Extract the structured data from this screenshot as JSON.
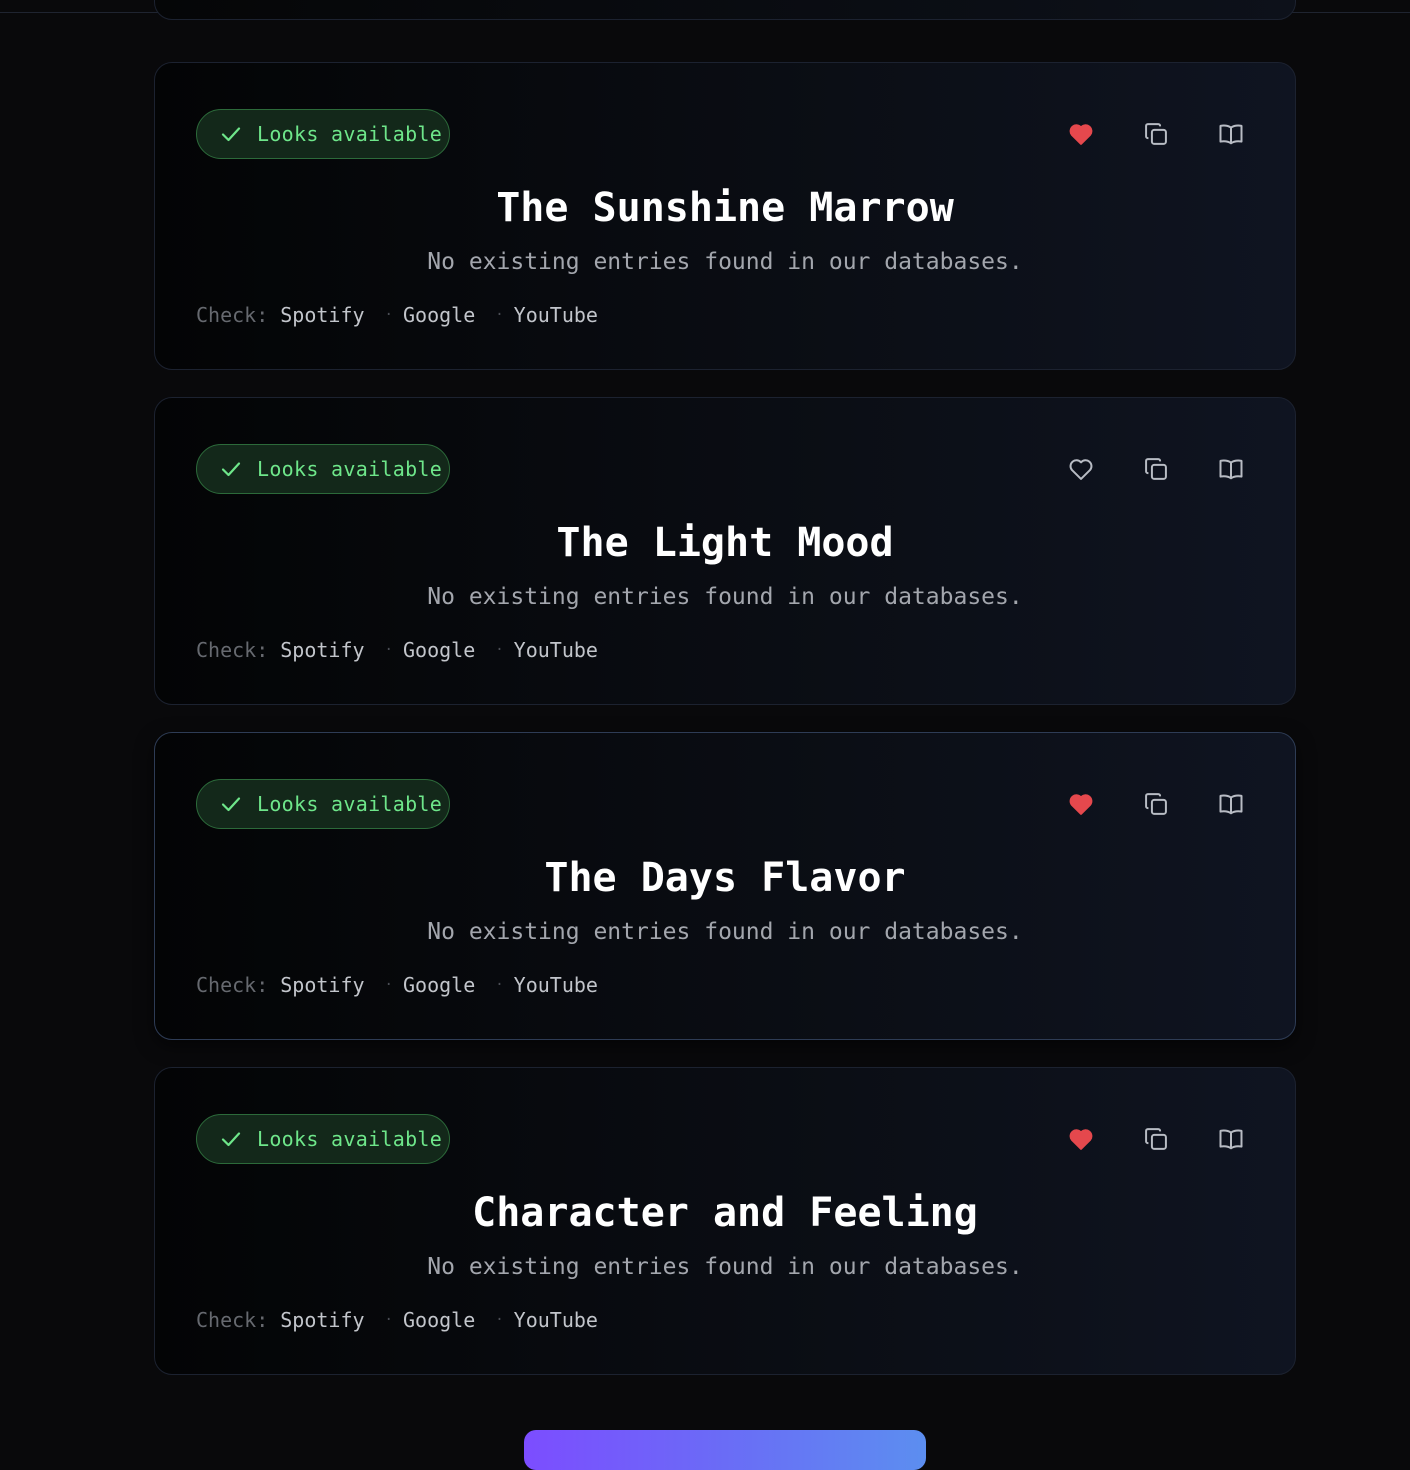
{
  "colors": {
    "accent_green": "#6ee68a",
    "heart_red": "#e5484d",
    "icon_gray": "#b8bcc4",
    "cta_gradient_start": "#7c4dff",
    "cta_gradient_end": "#5c8ef0"
  },
  "cards": [
    {
      "badge": "Looks available",
      "title": "The Sunshine Marrow",
      "subtitle": "No existing entries found in our databases.",
      "favorited": true,
      "check_label": "Check:",
      "links": [
        "Spotify",
        "Google",
        "YouTube"
      ],
      "separator": "·"
    },
    {
      "badge": "Looks available",
      "title": "The Light Mood",
      "subtitle": "No existing entries found in our databases.",
      "favorited": false,
      "check_label": "Check:",
      "links": [
        "Spotify",
        "Google",
        "YouTube"
      ],
      "separator": "·"
    },
    {
      "badge": "Looks available",
      "title": "The Days Flavor",
      "subtitle": "No existing entries found in our databases.",
      "favorited": true,
      "check_label": "Check:",
      "links": [
        "Spotify",
        "Google",
        "YouTube"
      ],
      "separator": "·"
    },
    {
      "badge": "Looks available",
      "title": "Character and Feeling",
      "subtitle": "No existing entries found in our databases.",
      "favorited": true,
      "check_label": "Check:",
      "links": [
        "Spotify",
        "Google",
        "YouTube"
      ],
      "separator": "·"
    }
  ],
  "icons": {
    "badge": "check-icon",
    "favorite": "heart-icon",
    "copy": "copy-icon",
    "dictionary": "book-open-icon"
  }
}
